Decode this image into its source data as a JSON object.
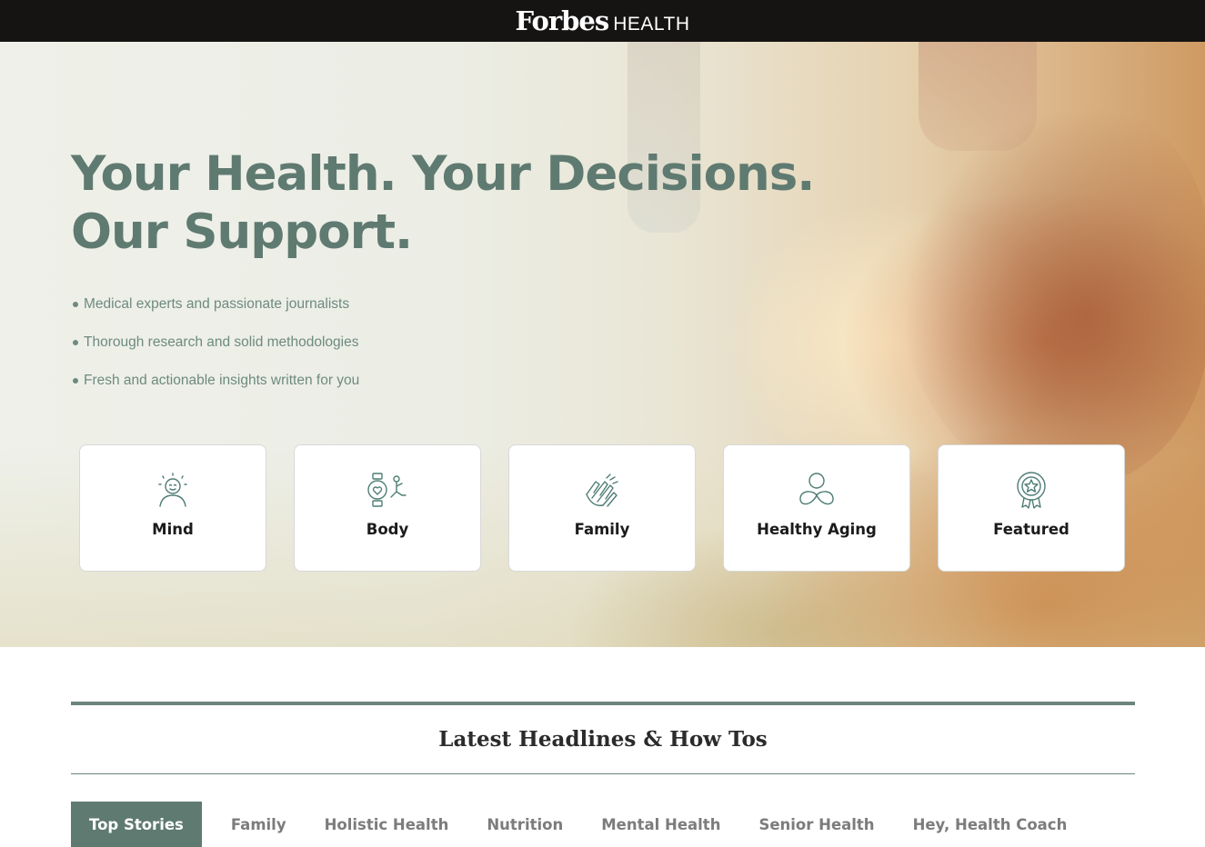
{
  "header": {
    "logo_main": "Forbes",
    "logo_sub": "HEALTH"
  },
  "hero": {
    "title_line1": "Your Health. Your Decisions.",
    "title_line2": "Our Support.",
    "bullets": [
      "Medical experts and passionate journalists",
      "Thorough research and solid methodologies",
      "Fresh and actionable insights written for you"
    ],
    "categories": [
      {
        "label": "Mind",
        "icon": "mind-icon"
      },
      {
        "label": "Body",
        "icon": "body-icon"
      },
      {
        "label": "Family",
        "icon": "family-icon"
      },
      {
        "label": "Healthy Aging",
        "icon": "healthy-aging-icon"
      },
      {
        "label": "Featured",
        "icon": "featured-icon"
      }
    ]
  },
  "headlines": {
    "title": "Latest Headlines & How Tos",
    "tabs": [
      {
        "label": "Top Stories",
        "active": true
      },
      {
        "label": "Family",
        "active": false
      },
      {
        "label": "Holistic Health",
        "active": false
      },
      {
        "label": "Nutrition",
        "active": false
      },
      {
        "label": "Mental Health",
        "active": false
      },
      {
        "label": "Senior Health",
        "active": false
      },
      {
        "label": "Hey, Health Coach",
        "active": false
      }
    ]
  },
  "colors": {
    "topbar": "#161413",
    "accent": "#5f7a71",
    "icon_stroke": "#4f7d75"
  }
}
